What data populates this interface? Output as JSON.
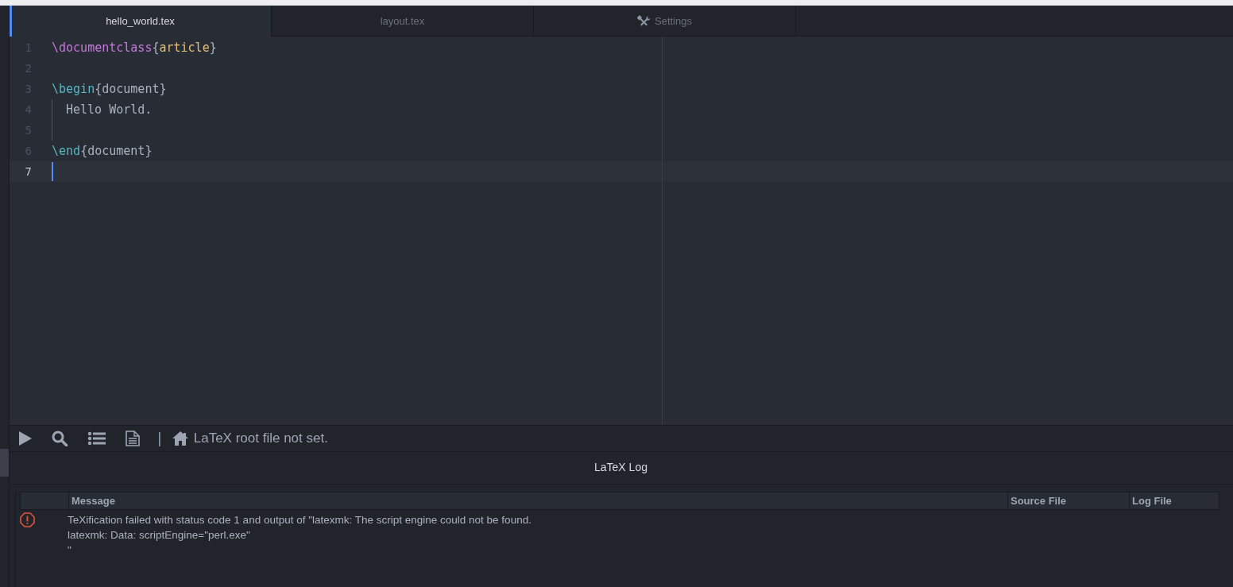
{
  "tabs": [
    {
      "label": "hello_world.tex",
      "selected": true,
      "kind": "file"
    },
    {
      "label": "layout.tex",
      "selected": false,
      "kind": "file"
    },
    {
      "label": "Settings",
      "selected": false,
      "kind": "settings"
    }
  ],
  "editor": {
    "lines": [
      {
        "number": "1",
        "current": false,
        "indent": false,
        "tokens": [
          {
            "kind": "command",
            "text": "\\documentclass"
          },
          {
            "kind": "brace",
            "text": "{"
          },
          {
            "kind": "argument",
            "text": "article"
          },
          {
            "kind": "brace",
            "text": "}"
          }
        ]
      },
      {
        "number": "2",
        "current": false,
        "indent": false
      },
      {
        "number": "3",
        "current": false,
        "indent": false,
        "tokens": [
          {
            "kind": "environment",
            "text": "\\begin"
          },
          {
            "kind": "brace",
            "text": "{"
          },
          {
            "kind": "plain",
            "text": "document"
          },
          {
            "kind": "brace",
            "text": "}"
          }
        ]
      },
      {
        "number": "4",
        "current": false,
        "indent": true,
        "tokens": [
          {
            "kind": "plain",
            "text": "Hello World."
          }
        ]
      },
      {
        "number": "5",
        "current": false,
        "indent": true
      },
      {
        "number": "6",
        "current": false,
        "indent": false,
        "tokens": [
          {
            "kind": "environment",
            "text": "\\end"
          },
          {
            "kind": "brace",
            "text": "{"
          },
          {
            "kind": "plain",
            "text": "document"
          },
          {
            "kind": "brace",
            "text": "}"
          }
        ]
      },
      {
        "number": "7",
        "current": true,
        "indent": false
      }
    ]
  },
  "toolbar": {
    "separator": "|",
    "status": "LaTeX root file not set."
  },
  "log": {
    "title": "LaTeX Log",
    "columns": [
      "Message",
      "Source File",
      "Log File"
    ],
    "rows": [
      {
        "kind": "error",
        "message": [
          "TeXification failed with status code 1 and output of \"latexmk: The script engine could not be found.",
          "latexmk: Data: scriptEngine=\"perl.exe\"",
          "\""
        ]
      }
    ]
  }
}
